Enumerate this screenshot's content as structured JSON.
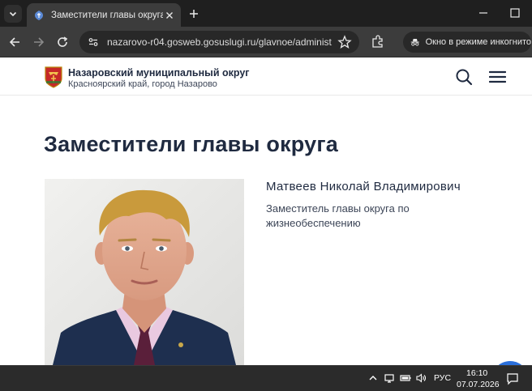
{
  "browser": {
    "tab_title": "Заместители главы округа",
    "url": "nazarovo-r04.gosweb.gosuslugi.ru/glavnoe/administ...",
    "incognito_label": "Окно в режиме инкогнито"
  },
  "site": {
    "name": "Назаровский муниципальный округ",
    "region": "Красноярский край, город Назарово"
  },
  "page": {
    "title": "Заместители главы округа"
  },
  "person": {
    "name": "Матвеев Николай Владимирович",
    "role": "Заместитель главы округа по жизнеобеспечению"
  },
  "taskbar": {
    "language": "РУС",
    "time": "16:10",
    "date": "07.07.2026"
  },
  "colors": {
    "chrome_dark": "#1f1f1f",
    "toolbar": "#3c3c3c",
    "heading": "#1f2a40",
    "accent_blue": "#2a6fdb"
  }
}
